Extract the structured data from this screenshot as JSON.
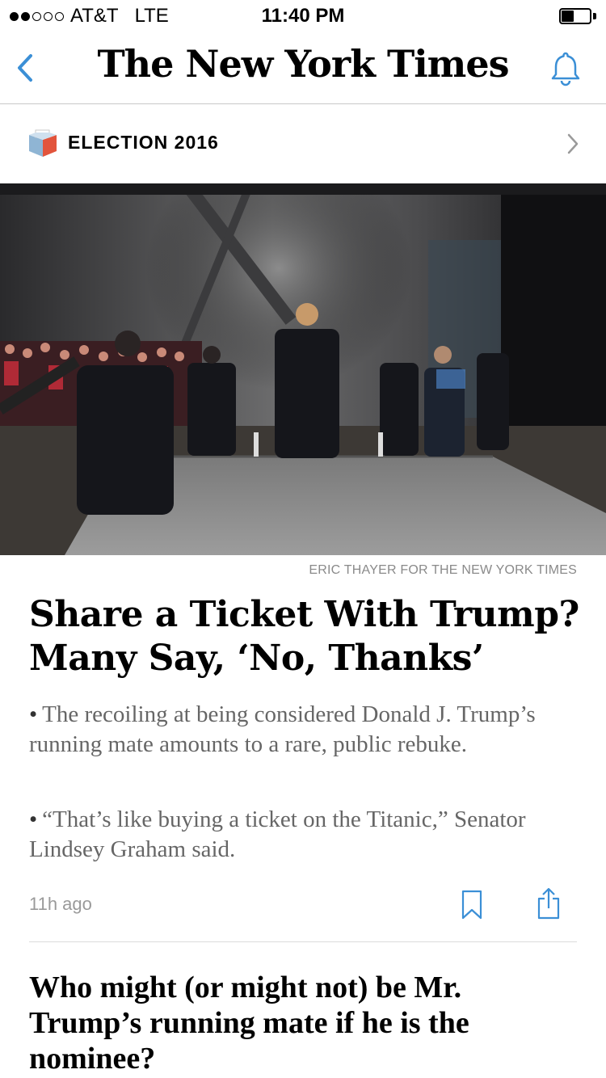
{
  "status_bar": {
    "carrier": "AT&T",
    "network": "LTE",
    "time": "11:40 PM",
    "signal_bars": 2,
    "signal_total": 5,
    "battery_level": 0.45
  },
  "nav": {
    "masthead": "The New York Times",
    "back_icon": "chevron-left-icon",
    "bell_icon": "bell-icon"
  },
  "section": {
    "label": "ELECTION 2016",
    "icon": "ballot-box-icon",
    "chevron_icon": "chevron-right-icon"
  },
  "article": {
    "photo_credit": "ERIC THAYER FOR THE NEW YORK TIMES",
    "headline_line1": "Share a Ticket With Trump?",
    "headline_line2": "Many Say, ‘No, Thanks’",
    "bullet_mark": "•",
    "bullets": [
      "The recoiling at being considered Donald J. Trump’s running mate amounts to a rare, public rebuke.",
      "“That’s like buying a ticket on the Titanic,” Senator Lindsey Graham said."
    ],
    "timestamp": "11h ago",
    "bookmark_icon": "bookmark-icon",
    "share_icon": "share-icon"
  },
  "next_article": {
    "headline": "Who might (or might not) be Mr. Trump’s running mate if he is the nominee?"
  },
  "colors": {
    "accent_blue": "#3b8fd6",
    "credit_gray": "#8a8a8a",
    "summary_gray": "#666666",
    "divider": "#dcdcdc"
  }
}
